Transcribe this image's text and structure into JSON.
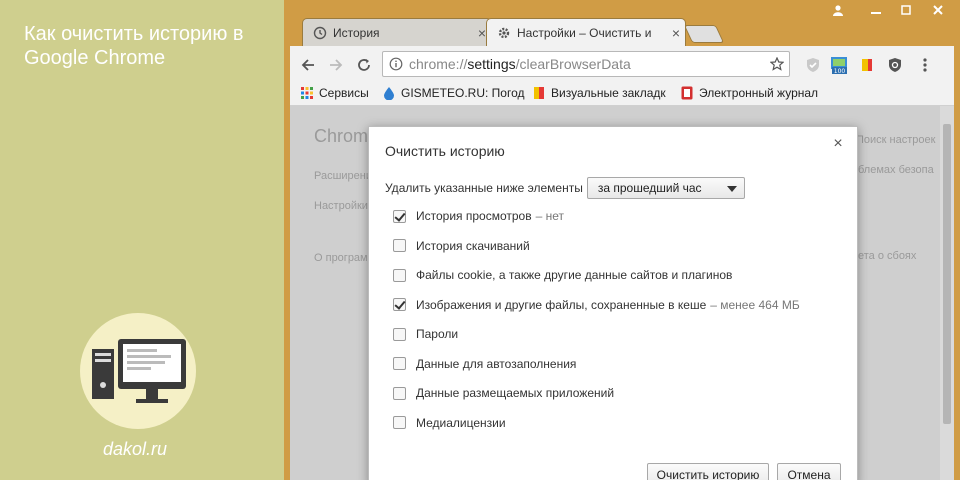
{
  "promo": {
    "title": "Как очистить историю в Google Chrome",
    "site": "dakol.ru"
  },
  "tabs": [
    {
      "label": "История",
      "icon": "history-icon",
      "active": false
    },
    {
      "label": "Настройки – Очистить и",
      "icon": "gear-icon",
      "active": true
    }
  ],
  "toolbar": {
    "url_prefix": "chrome://",
    "url_main": "settings",
    "url_suffix": "/clearBrowserData"
  },
  "bookmarks": [
    {
      "label": "Сервисы",
      "icon": "apps-grid-icon"
    },
    {
      "label": "GISMETEO.RU: Погод",
      "icon": "weather-drop-icon"
    },
    {
      "label": "Визуальные закладк",
      "icon": "bookmark-flag-icon"
    },
    {
      "label": "Электронный журнал",
      "icon": "journal-icon"
    }
  ],
  "page": {
    "header": "Chrome",
    "search_placeholder": "Поиск настроек",
    "nav": [
      "Расширения",
      "Настройки",
      "О программе"
    ],
    "side_text_1": "блемах безопа",
    "side_text_2": "ета о сбоях"
  },
  "dialog": {
    "title": "Очистить историю",
    "period_label": "Удалить указанные ниже элементы",
    "period_value": "за прошедший час",
    "options": [
      {
        "label": "История просмотров",
        "checked": true,
        "note": "– нет"
      },
      {
        "label": "История скачиваний",
        "checked": false,
        "note": ""
      },
      {
        "label": "Файлы cookie, а также другие данные сайтов и плагинов",
        "checked": false,
        "note": ""
      },
      {
        "label": "Изображения и другие файлы, сохраненные в кеше",
        "checked": true,
        "note": "– менее 464 МБ"
      },
      {
        "label": "Пароли",
        "checked": false,
        "note": ""
      },
      {
        "label": "Данные для автозаполнения",
        "checked": false,
        "note": ""
      },
      {
        "label": "Данные размещаемых приложений",
        "checked": false,
        "note": ""
      },
      {
        "label": "Медиалицензии",
        "checked": false,
        "note": ""
      }
    ],
    "clear_button": "Очистить историю",
    "cancel_button": "Отмена"
  },
  "colors": {
    "promo_bg": "#cfcf8e",
    "frame": "#d09c45",
    "overlay": "#cfcfcf"
  }
}
